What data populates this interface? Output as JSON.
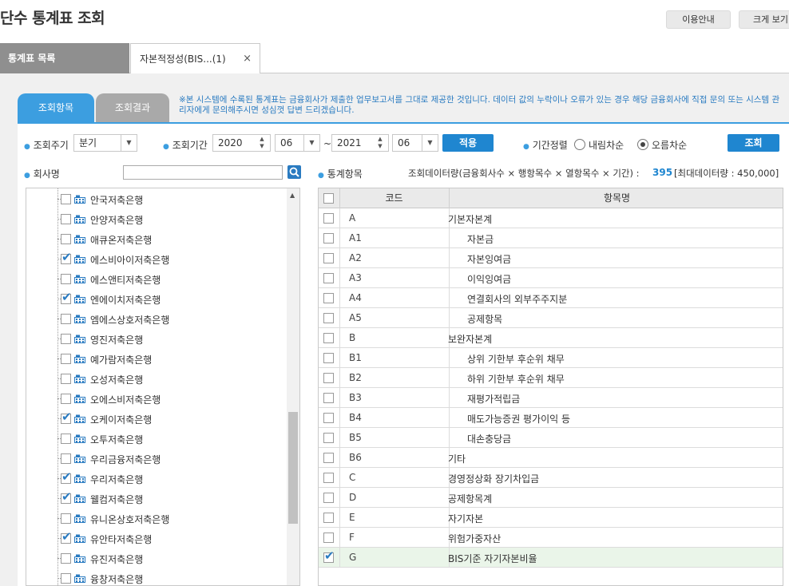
{
  "header": {
    "title": "단수 통계표 조회",
    "guide_button": "이용안내",
    "zoom_button": "크게 보기"
  },
  "tabs": {
    "list_tab": "통계표 목록",
    "active_tab": "자본적정성(BIS...(1)",
    "close_glyph": "×"
  },
  "subtabs": {
    "query": "조회항목",
    "result": "조회결과"
  },
  "notice": "※본 시스템에 수록된 통계표는 금융회사가 제출한 업무보고서를 그대로 제공한 것입니다. 데이터 값의 누락이나 오류가 있는 경우 해당 금융회사에 직접 문의 또는 시스템 관리자에게 문의해주시면 성심껏 답변 드리겠습니다.",
  "filters": {
    "cycle_label": "조회주기",
    "cycle_value": "분기",
    "period_label": "조회기간",
    "from_year": "2020",
    "from_month": "06",
    "tilde": "~",
    "to_year": "2021",
    "to_month": "06",
    "apply_button": "적용",
    "sort_label": "기간정렬",
    "sort_desc": "내림차순",
    "sort_asc": "오름차순",
    "sort_selected": "오름차순",
    "search_button": "조회"
  },
  "company": {
    "label": "회사명",
    "search_value": "",
    "items": [
      {
        "name": "안국저축은행",
        "checked": false
      },
      {
        "name": "안양저축은행",
        "checked": false
      },
      {
        "name": "애큐온저축은행",
        "checked": false
      },
      {
        "name": "에스비아이저축은행",
        "checked": true
      },
      {
        "name": "에스앤티저축은행",
        "checked": false
      },
      {
        "name": "엔에이치저축은행",
        "checked": true
      },
      {
        "name": "엠에스상호저축은행",
        "checked": false
      },
      {
        "name": "영진저축은행",
        "checked": false
      },
      {
        "name": "예가람저축은행",
        "checked": false
      },
      {
        "name": "오성저축은행",
        "checked": false
      },
      {
        "name": "오에스비저축은행",
        "checked": false
      },
      {
        "name": "오케이저축은행",
        "checked": true
      },
      {
        "name": "오투저축은행",
        "checked": false
      },
      {
        "name": "우리금융저축은행",
        "checked": false
      },
      {
        "name": "우리저축은행",
        "checked": true
      },
      {
        "name": "웰컴저축은행",
        "checked": true
      },
      {
        "name": "유니온상호저축은행",
        "checked": false
      },
      {
        "name": "유안타저축은행",
        "checked": true
      },
      {
        "name": "유진저축은행",
        "checked": false
      },
      {
        "name": "융창저축은행",
        "checked": false
      }
    ]
  },
  "stats": {
    "label": "통계항목",
    "data_volume_label": "조회데이터량(금융회사수 × 행항목수 × 열항목수 × 기간) :",
    "data_volume_value": "395",
    "data_volume_max": "[최대데이터량 : 450,000]",
    "col_code": "코드",
    "col_name": "항목명",
    "rows": [
      {
        "code": "A",
        "name": "기본자본계",
        "indent": 0,
        "checked": false
      },
      {
        "code": "A1",
        "name": "자본금",
        "indent": 1,
        "checked": false
      },
      {
        "code": "A2",
        "name": "자본잉여금",
        "indent": 1,
        "checked": false
      },
      {
        "code": "A3",
        "name": "이익잉여금",
        "indent": 1,
        "checked": false
      },
      {
        "code": "A4",
        "name": "연결회사의 외부주주지분",
        "indent": 1,
        "checked": false
      },
      {
        "code": "A5",
        "name": "공제항목",
        "indent": 1,
        "checked": false
      },
      {
        "code": "B",
        "name": "보완자본계",
        "indent": 0,
        "checked": false
      },
      {
        "code": "B1",
        "name": "상위 기한부 후순위 채무",
        "indent": 1,
        "checked": false
      },
      {
        "code": "B2",
        "name": "하위 기한부 후순위 채무",
        "indent": 1,
        "checked": false
      },
      {
        "code": "B3",
        "name": "재평가적립금",
        "indent": 1,
        "checked": false
      },
      {
        "code": "B4",
        "name": "매도가능증권 평가이익 등",
        "indent": 1,
        "checked": false
      },
      {
        "code": "B5",
        "name": "대손충당금",
        "indent": 1,
        "checked": false
      },
      {
        "code": "B6",
        "name": "기타",
        "indent": 0,
        "checked": false
      },
      {
        "code": "C",
        "name": "경영정상화 장기차입금",
        "indent": 0,
        "checked": false
      },
      {
        "code": "D",
        "name": "공제항목계",
        "indent": 0,
        "checked": false
      },
      {
        "code": "E",
        "name": "자기자본",
        "indent": 0,
        "checked": false
      },
      {
        "code": "F",
        "name": "위험가중자산",
        "indent": 0,
        "checked": false
      },
      {
        "code": "G",
        "name": "BIS기준 자기자본비율",
        "indent": 0,
        "checked": true
      }
    ]
  },
  "colors": {
    "accent": "#3c9ee0",
    "button_blue": "#1f86d0",
    "notice_text": "#2a7bc1",
    "selected_row": "#eaf5e9"
  }
}
